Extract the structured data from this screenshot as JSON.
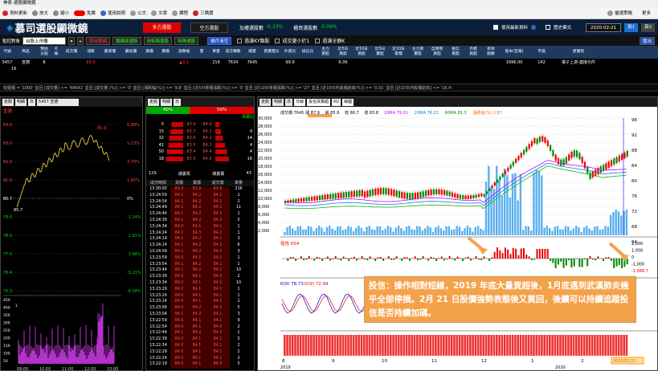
{
  "titlebar": {
    "title": "神奇-選股顯微鏡"
  },
  "menu": {
    "items": [
      "資料更新",
      "放大",
      "縮小",
      "免費",
      "使用說明",
      "公文",
      "文章",
      "課程",
      "三隣寶"
    ],
    "right": [
      "優選策略",
      "更多"
    ]
  },
  "header": {
    "brand": "慕司選股顯微鏡",
    "btn_long": "多方選股",
    "btn_short": "空方選股",
    "stat1_label": "加權選股數",
    "stat1_value": "-0.33%",
    "stat2_label": "櫃買選股數",
    "stat2_value": "-0.06%",
    "chk_latest": "使用最新資料",
    "chk_hist": "歷史模式",
    "date": "2020-02-21",
    "tab1": "頁1",
    "tab2": "頁2"
  },
  "toolbar": {
    "monitor_label": "監控對象",
    "market": "台股上市櫃",
    "buttons": [
      "即時籌碼",
      "籌碼面選股",
      "技術面選股",
      "特殊選股"
    ],
    "btn_reset": "條件清空",
    "chk1": "過濾KY類股",
    "chk2": "成交量小於1",
    "chk3": "過濾全額K",
    "export": "匯出"
  },
  "grid": {
    "headers": [
      "代號",
      "商品",
      "預估\n分點",
      "K\n線",
      "成交價",
      "漲跌",
      "最高價",
      "最低價",
      "買價",
      "賣價",
      "漲跌幅",
      "量",
      "單量",
      "成交筆數",
      "總量",
      "買賣量比",
      "外資比",
      "投信比",
      "主力\n買超",
      "近5日\n買超",
      "近10日\n買超",
      "近5日\n賣超",
      "近10日\n累積",
      "主力買\n賣超",
      "自營商\n買超",
      "投信\n買超",
      "外資\n買超",
      "有效\n股數",
      "股本(百萬)",
      "市值",
      "產業別"
    ],
    "row": {
      "code": "5457",
      "name": "宣德",
      "v1": "8",
      "price": "85.9",
      "chg": "▲3.2",
      "vol": "216",
      "v2": "7634",
      "v3": "7645",
      "v4": "99.9",
      "v5": "6.06",
      "v6": "1696.00",
      "v7": "142",
      "industry": "電子上游-連接元件"
    },
    "row2": {
      "v": "16"
    }
  },
  "condition": "收盤價 = '1000' 並且 [成交量] <= '49641' 並且 [成交量 (%)] >= '0' 並且 [漲跌幅(%)] <= '9.8' 並且 [近5日累積漲跌(%)] <= '0' 並且 [近10日累積漲跌(%)] >= '27' 並且 [近10日內股價創高(%)] >= '0.01' 並且 [近10日內股價創高] <= '16.4'",
  "left_panel": {
    "tabs": [
      "走勢",
      "明細",
      "日"
    ],
    "stock": "5457 宣德",
    "label_name": "宣德",
    "high": "85.9",
    "price": "85.7",
    "right_ticks": [
      "6.88%",
      "5.23%",
      "3.70%",
      "1.85%",
      "0%",
      "-1.24%",
      "-2.81%",
      "-3.88%",
      "-5.21%",
      "-6.58%"
    ],
    "left_ticks": [
      "84.0",
      "83.0",
      "82.0",
      "81.0",
      "80.7",
      "79.6",
      "78.5",
      "77.5",
      "76.4",
      "75.3"
    ],
    "vol_ticks": [
      "450",
      "400",
      "350",
      "300",
      "250",
      "200",
      "150",
      "100",
      "50"
    ],
    "time_ticks": [
      "09:00",
      "10:00",
      "11:00",
      "12:00",
      "13:00"
    ],
    "vol_x": "1"
  },
  "mid_panel": {
    "tabs": [
      "走勢",
      "明細",
      "日"
    ],
    "ratio_left": "40%",
    "ratio_right": "59%",
    "ratio_label": "買賣比",
    "book": [
      [
        "5",
        "",
        "83.9",
        "84.0",
        ""
      ],
      [
        "15",
        "",
        "83.7",
        "84.1",
        "9"
      ],
      [
        "32",
        "",
        "83.6",
        "84.2",
        "14"
      ],
      [
        "41",
        "",
        "83.5",
        "84.3",
        "4"
      ],
      [
        "50",
        "",
        "83.4",
        "84.4",
        "4"
      ]
    ],
    "book_last": [
      "18",
      "",
      "83.3",
      "84.5",
      "16"
    ],
    "stats": [
      "129",
      "總委買",
      "總委賣",
      "43"
    ],
    "detail_headers": [
      "成交時間",
      "買價",
      "賣價",
      "成交價",
      "單量"
    ],
    "details": [
      [
        "13:30:00",
        "83.9",
        "83.9",
        "83.9",
        "216"
      ],
      [
        "13:24:59",
        "84.1",
        "84.2",
        "84.1",
        "1"
      ],
      [
        "13:24:54",
        "84.1",
        "84.2",
        "84.1",
        "2"
      ],
      [
        "13:24:49",
        "84.1",
        "84.2",
        "84.1",
        "11"
      ],
      [
        "13:24:44",
        "84.1",
        "84.2",
        "84.1",
        "1"
      ],
      [
        "13:24:39",
        "84.1",
        "84.2",
        "84.2",
        "5"
      ],
      [
        "13:24:34",
        "84.0",
        "84.1",
        "84.1",
        "1"
      ],
      [
        "13:24:24",
        "84.1",
        "84.3",
        "84.2",
        "1"
      ],
      [
        "13:24:19",
        "84.1",
        "84.2",
        "84.1",
        "3"
      ],
      [
        "13:24:14",
        "84.1",
        "84.2",
        "84.2",
        "6"
      ],
      [
        "13:24:09",
        "84.1",
        "84.2",
        "84.2",
        "3"
      ],
      [
        "13:23:59",
        "84.0",
        "84.1",
        "84.0",
        "1"
      ],
      [
        "13:23:54",
        "84.1",
        "84.2",
        "84.1",
        "1"
      ],
      [
        "13:23:44",
        "84.1",
        "84.2",
        "84.1",
        "10"
      ],
      [
        "13:23:39",
        "84.0",
        "84.1",
        "84.0",
        "2"
      ],
      [
        "13:23:34",
        "84.0",
        "84.1",
        "84.1",
        "10"
      ],
      [
        "13:23:29",
        "84.0",
        "84.1",
        "84.1",
        "1"
      ],
      [
        "13:23:24",
        "84.0",
        "84.1",
        "84.1",
        "1"
      ],
      [
        "13:23:14",
        "84.0",
        "84.1",
        "84.1",
        "2"
      ],
      [
        "13:23:09",
        "84.0",
        "84.2",
        "84.1",
        "5"
      ],
      [
        "13:23:04",
        "84.1",
        "84.2",
        "84.1",
        "3"
      ],
      [
        "13:22:59",
        "84.0",
        "84.1",
        "84.1",
        "9"
      ],
      [
        "13:22:54",
        "84.0",
        "84.1",
        "84.0",
        "2"
      ],
      [
        "13:22:44",
        "84.1",
        "84.2",
        "84.2",
        "1"
      ],
      [
        "13:22:39",
        "84.0",
        "84.1",
        "84.1",
        "5"
      ],
      [
        "13:22:34",
        "84.0",
        "84.1",
        "84.1",
        "2"
      ],
      [
        "13:22:29",
        "84.0",
        "84.1",
        "84.1",
        "2"
      ],
      [
        "13:22:24",
        "84.0",
        "84.1",
        "84.1",
        "2"
      ],
      [
        "13:22:19",
        "84.0",
        "84.1",
        "84.0",
        "5"
      ]
    ]
  },
  "right_panel": {
    "tabs": [
      "走勢",
      "明細",
      "日",
      "格數",
      "K"
    ],
    "chips": [
      "日線",
      "投信買賣超",
      "KD",
      "線圖"
    ],
    "legend": {
      "close": "成交價 7645",
      "v1": "開 87.9",
      "v2": "最 85.9",
      "v3": "低 80.7",
      "v4": "收 83.8",
      "ma10": "10MA 79.01",
      "ma20": "20MA 78.22",
      "ma60": "60MA 81.3",
      "extra": "漲跌幅(%) 3.87"
    },
    "vol_ticks": [
      "30,000",
      "28,000",
      "26,000",
      "24,000",
      "22,000",
      "20,000",
      "18,000",
      "16,000",
      "14,000",
      "12,000",
      "10,000",
      "8,000",
      "6,000",
      "4,000",
      "2,000"
    ],
    "price_ticks": [
      "96",
      "92",
      "88",
      "84",
      "80",
      "76",
      "72",
      "68",
      "64"
    ],
    "inv_label": "投信 654",
    "inv_ticks": [
      "2,000",
      "1,000",
      "0",
      "-1,000",
      "-1,588.7"
    ],
    "kd_label": "K(9) 78.73",
    "kd_label2": "D(9) 72.99",
    "x_ticks": [
      "8",
      "9",
      "10",
      "11",
      "12",
      "1",
      "2"
    ],
    "year1": "2019",
    "year2": "2020",
    "date_tag": "2020/02/21"
  },
  "callout": {
    "text": "投信：操作相對短線，2019 年底大量買超後，1月底遇到武漢肺炎幾乎全部停損。2月 21 日股價強勢表態後又買回，後續可以持續追蹤投信是否持續加碼。"
  },
  "colors": {
    "up": "#ff2020",
    "down": "#00c000",
    "accent": "#f4a24a",
    "navy": "#0b1f3a"
  }
}
